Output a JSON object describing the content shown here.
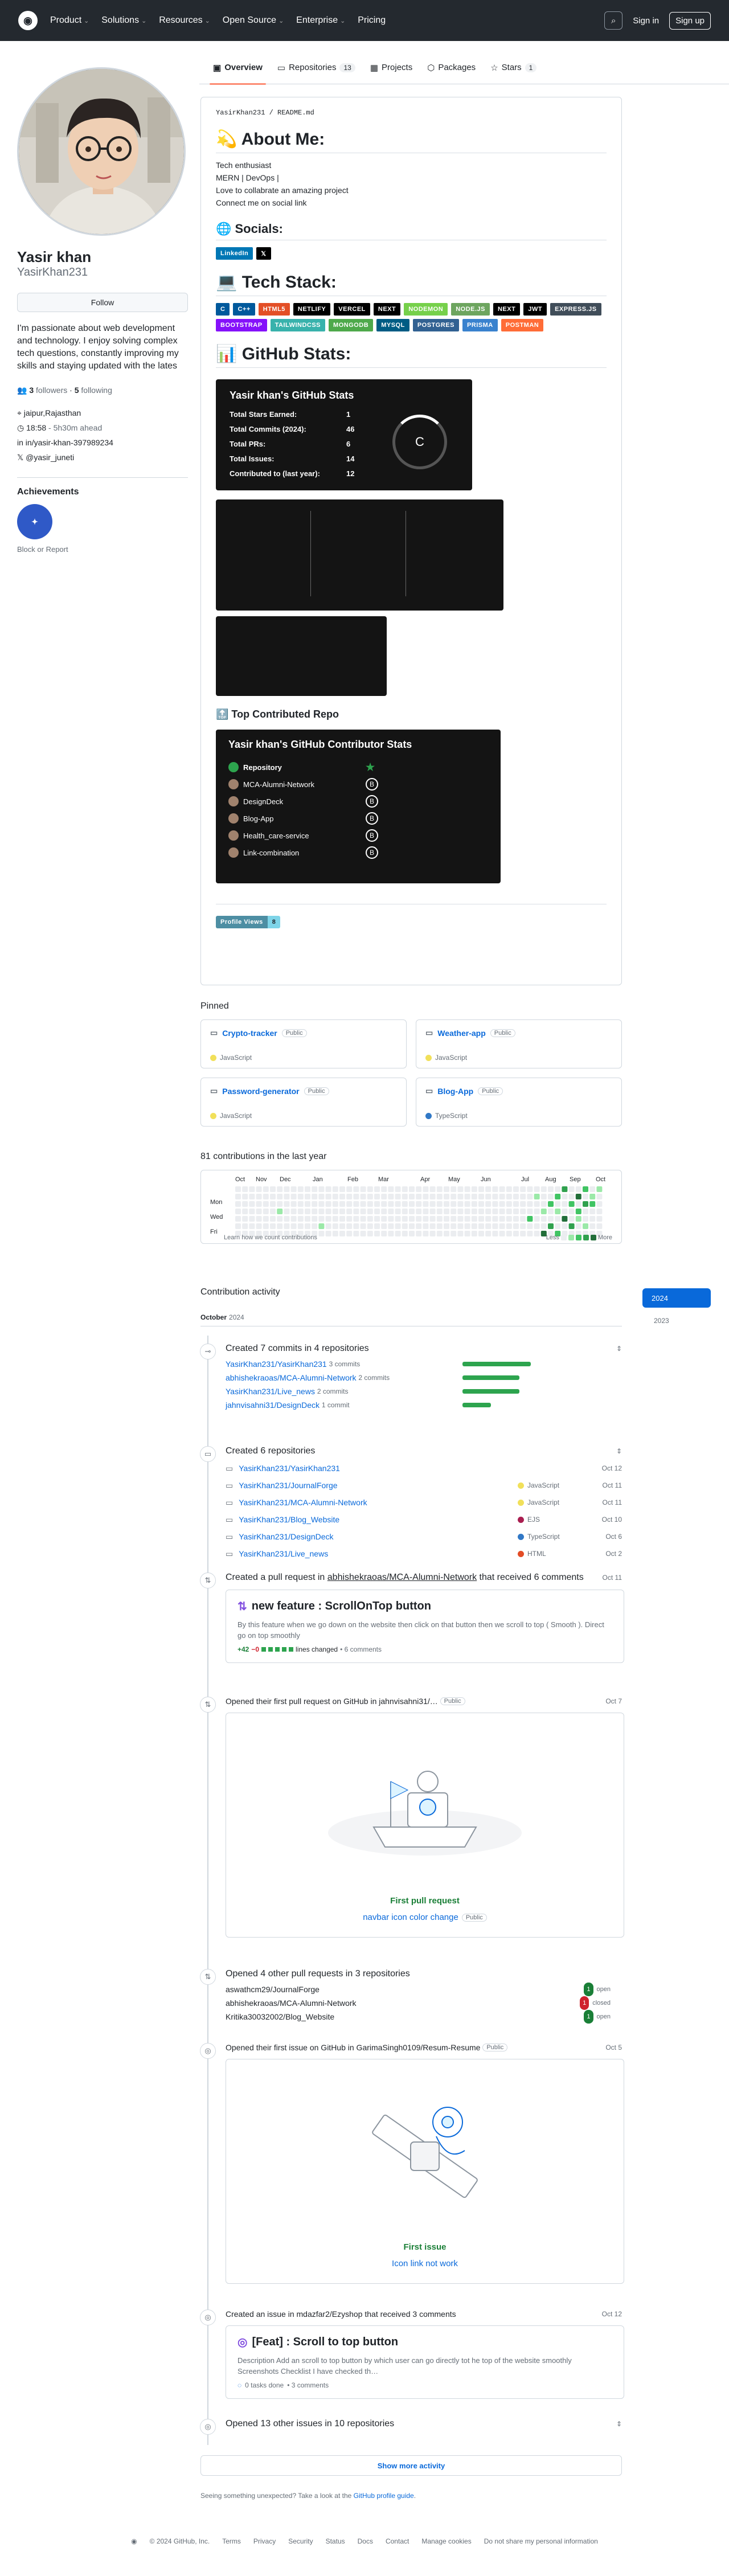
{
  "header": {
    "nav": [
      "Product",
      "Solutions",
      "Resources",
      "Open Source",
      "Enterprise",
      "Pricing"
    ],
    "signin": "Sign in",
    "signup": "Sign up"
  },
  "tabs": [
    {
      "label": "Overview",
      "count": ""
    },
    {
      "label": "Repositories",
      "count": "13"
    },
    {
      "label": "Projects",
      "count": ""
    },
    {
      "label": "Packages",
      "count": ""
    },
    {
      "label": "Stars",
      "count": "1"
    }
  ],
  "profile": {
    "name": "Yasir khan",
    "username": "YasirKhan231",
    "follow": "Follow",
    "bio": "I'm passionate about web development and technology. I enjoy solving complex tech questions, constantly improving my skills and staying updated with the lates",
    "followers": "3",
    "followers_label": "followers",
    "following": "5",
    "following_label": "following",
    "location": "jaipur,Rajasthan",
    "time": "18:58",
    "time_note": "- 5h30m ahead",
    "linkedin": "in/yasir-khan-397989234",
    "twitter": "@yasir_juneti",
    "achievements": "Achievements",
    "block": "Block or Report"
  },
  "readme": {
    "path": "YasirKhan231 / README.md",
    "about_title": "💫 About Me:",
    "about_lines": [
      "Tech enthusiast",
      "MERN | DevOps |",
      "Love to collabrate an amazing project",
      "Connect me on social link"
    ],
    "socials_title": "🌐 Socials:",
    "social_badges": [
      "LinkedIn",
      "𝕏"
    ],
    "tech_title": "💻 Tech Stack:",
    "tech_badges": [
      "C",
      "C++",
      "HTML5",
      "NETLIFY",
      "VERCEL",
      "NEXT",
      "NODEMON",
      "NODE.JS",
      "NEXT",
      "JWT",
      "EXPRESS.JS",
      "BOOTSTRAP",
      "TAILWINDCSS",
      "MONGODB",
      "MYSQL",
      "POSTGRES",
      "PRISMA",
      "POSTMAN"
    ],
    "stats_title": "📊 GitHub Stats:",
    "stats_card": {
      "title": "Yasir khan's GitHub Stats",
      "rows": [
        {
          "k": "Total Stars Earned:",
          "v": "1"
        },
        {
          "k": "Total Commits (2024):",
          "v": "46"
        },
        {
          "k": "Total PRs:",
          "v": "6"
        },
        {
          "k": "Total Issues:",
          "v": "14"
        },
        {
          "k": "Contributed to (last year):",
          "v": "12"
        }
      ],
      "grade": "C"
    },
    "top_repo_title": "🔝 Top Contributed Repo",
    "contrib_card": {
      "title": "Yasir khan's GitHub Contributor Stats",
      "header": "Repository",
      "repos": [
        "MCA-Alumni-Network",
        "DesignDeck",
        "Blog-App",
        "Health_care-service",
        "Link-combination"
      ],
      "rank": "B"
    },
    "views_label": "Profile Views",
    "views": "8"
  },
  "pinned": {
    "title": "Pinned",
    "items": [
      {
        "name": "Crypto-tracker",
        "tag": "Public",
        "lang": "JavaScript",
        "color": "#f1e05a"
      },
      {
        "name": "Weather-app",
        "tag": "Public",
        "lang": "JavaScript",
        "color": "#f1e05a"
      },
      {
        "name": "Password-generator",
        "tag": "Public",
        "lang": "JavaScript",
        "color": "#f1e05a"
      },
      {
        "name": "Blog-App",
        "tag": "Public",
        "lang": "TypeScript",
        "color": "#3178c6"
      }
    ]
  },
  "contributions": {
    "title": "81 contributions in the last year",
    "months": [
      "Oct",
      "Nov",
      "Dec",
      "Jan",
      "Feb",
      "Mar",
      "Apr",
      "May",
      "Jun",
      "Jul",
      "Aug",
      "Sep",
      "Oct"
    ],
    "days": [
      "Mon",
      "Wed",
      "Fri"
    ],
    "learn": "Learn how we count contributions",
    "less": "Less",
    "more": "More"
  },
  "activity": {
    "title": "Contribution activity",
    "month": "October",
    "year": "2024",
    "years": [
      "2024",
      "2023"
    ],
    "commits": {
      "title": "Created 7 commits in 4 repositories",
      "rows": [
        {
          "repo": "YasirKhan231/YasirKhan231",
          "n": "3 commits",
          "w": 60
        },
        {
          "repo": "abhishekraoas/MCA-Alumni-Network",
          "n": "2 commits",
          "w": 50
        },
        {
          "repo": "YasirKhan231/Live_news",
          "n": "2 commits",
          "w": 50
        },
        {
          "repo": "jahnvisahni31/DesignDeck",
          "n": "1 commit",
          "w": 25
        }
      ]
    },
    "repos": {
      "title": "Created 6 repositories",
      "rows": [
        {
          "repo": "YasirKhan231/YasirKhan231",
          "lang": "",
          "date": "Oct 12"
        },
        {
          "repo": "YasirKhan231/JournalForge",
          "lang": "JavaScript",
          "date": "Oct 11",
          "color": "#f1e05a"
        },
        {
          "repo": "YasirKhan231/MCA-Alumni-Network",
          "lang": "JavaScript",
          "date": "Oct 11",
          "color": "#f1e05a"
        },
        {
          "repo": "YasirKhan231/Blog_Website",
          "lang": "EJS",
          "date": "Oct 10",
          "color": "#a91e50"
        },
        {
          "repo": "YasirKhan231/DesignDeck",
          "lang": "TypeScript",
          "date": "Oct 6",
          "color": "#3178c6"
        },
        {
          "repo": "YasirKhan231/Live_news",
          "lang": "HTML",
          "date": "Oct 2",
          "color": "#e34c26"
        }
      ]
    },
    "pr": {
      "title_pre": "Created a pull request in ",
      "repo": "abhishekraoas/MCA-Alumni-Network",
      "title_post": " that received 6 comments",
      "date": "Oct 11",
      "pr_title": "new feature : ScrollOnTop button",
      "pr_body": "By this feature when we go down on the website then click on that button then we scroll to top ( Smooth ). Direct go on top smoothly",
      "add": "+42",
      "del": "−0",
      "lines": "lines changed",
      "comments": "• 6 comments"
    },
    "first_pr": {
      "title": "Opened their first pull request on GitHub in jahnvisahni31/…",
      "tag": "Public",
      "date": "Oct 7",
      "label": "First pull request",
      "link": "navbar icon color change",
      "tag2": "Public"
    },
    "other_prs": {
      "title": "Opened 4 other pull requests in 3 repositories",
      "rows": [
        {
          "repo": "aswathcm29/JournalForge",
          "st": "open",
          "n": "1"
        },
        {
          "repo": "abhishekraoas/MCA-Alumni-Network",
          "st": "closed",
          "n": "1"
        },
        {
          "repo": "Kritika30032002/Blog_Website",
          "st": "open",
          "n": "1"
        }
      ]
    },
    "first_issue": {
      "title": "Opened their first issue on GitHub in GarimaSingh0109/Resum-Resume",
      "tag": "Public",
      "date": "Oct 5",
      "label": "First issue",
      "link": "Icon link not work"
    },
    "issue": {
      "title": "Created an issue in mdazfar2/Ezyshop that received 3 comments",
      "date": "Oct 12",
      "it": "[Feat] : Scroll to top button",
      "body": "Description Add an scroll to top button by which user can go directly tot he top of the website smoothly Screenshots Checklist I have checked th…",
      "tasks": "0 tasks done",
      "comments": "• 3 comments"
    },
    "other_issues": "Opened 13 other issues in 10 repositories",
    "show_more": "Show more activity",
    "feedback_pre": "Seeing something unexpected? Take a look at the ",
    "feedback_link": "GitHub profile guide",
    "feedback_post": "."
  },
  "footer": [
    "© 2024 GitHub, Inc.",
    "Terms",
    "Privacy",
    "Security",
    "Status",
    "Docs",
    "Contact",
    "Manage cookies",
    "Do not share my personal information"
  ]
}
